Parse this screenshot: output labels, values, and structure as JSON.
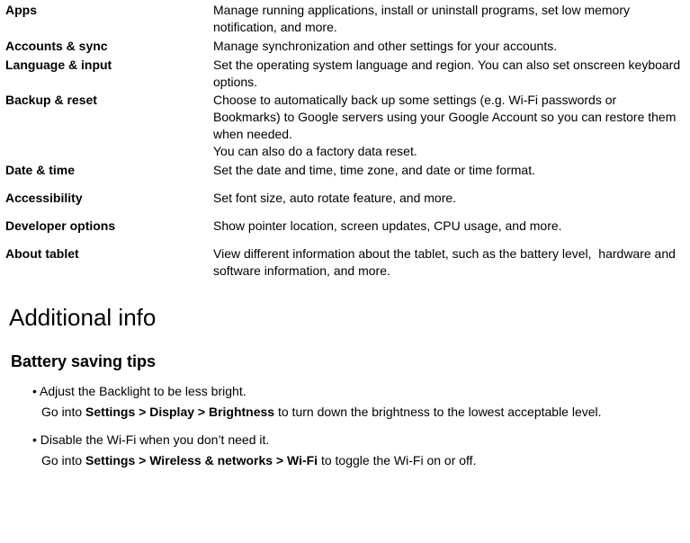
{
  "settings": [
    {
      "term": "Apps",
      "desc": [
        "Manage running applications, install or uninstall programs, set low memory notification, and more."
      ],
      "gap": false
    },
    {
      "term": "Accounts & sync",
      "desc": [
        "Manage synchronization and other settings for your accounts."
      ],
      "gap": false
    },
    {
      "term": "Language & input",
      "desc": [
        "Set the operating system language and region. You can also set onscreen keyboard options."
      ],
      "gap": false
    },
    {
      "term": "Backup & reset",
      "desc": [
        "Choose to automatically back up some settings (e.g. Wi-Fi passwords or Bookmarks) to Google servers using your Google Account so you can restore them when needed.",
        "You can also do a factory data reset."
      ],
      "gap": false
    },
    {
      "term": "Date & time",
      "desc": [
        "Set the date and time, time zone, and date or time format."
      ],
      "gap": false
    },
    {
      "term": "Accessibility",
      "desc": [
        "Set font size, auto rotate feature, and more."
      ],
      "gap": true
    },
    {
      "term": "Developer options",
      "desc": [
        "Show pointer location, screen updates, CPU usage, and more."
      ],
      "gap": true
    },
    {
      "term": "About tablet",
      "desc": [
        "View different information about the tablet, such as the battery level,  hardware and software information, and more."
      ],
      "gap": true
    }
  ],
  "sections": {
    "additional_title": "Additional info",
    "battery_title": "Battery saving tips"
  },
  "tips": [
    {
      "head_bullet": "•",
      "head_plain": " Adjust the Backlight to be less bright.",
      "body_pre": "Go into ",
      "body_bold": "Settings > Display > Brightness",
      "body_post": " to turn down the brightness to the lowest acceptable level."
    },
    {
      "head_bullet": "•",
      "head_plain": " Disable the Wi-Fi when you don’t need it.",
      "body_pre": "Go into ",
      "body_bold": "Settings > Wireless & networks > Wi-Fi",
      "body_post": " to toggle the Wi-Fi on or off."
    }
  ]
}
